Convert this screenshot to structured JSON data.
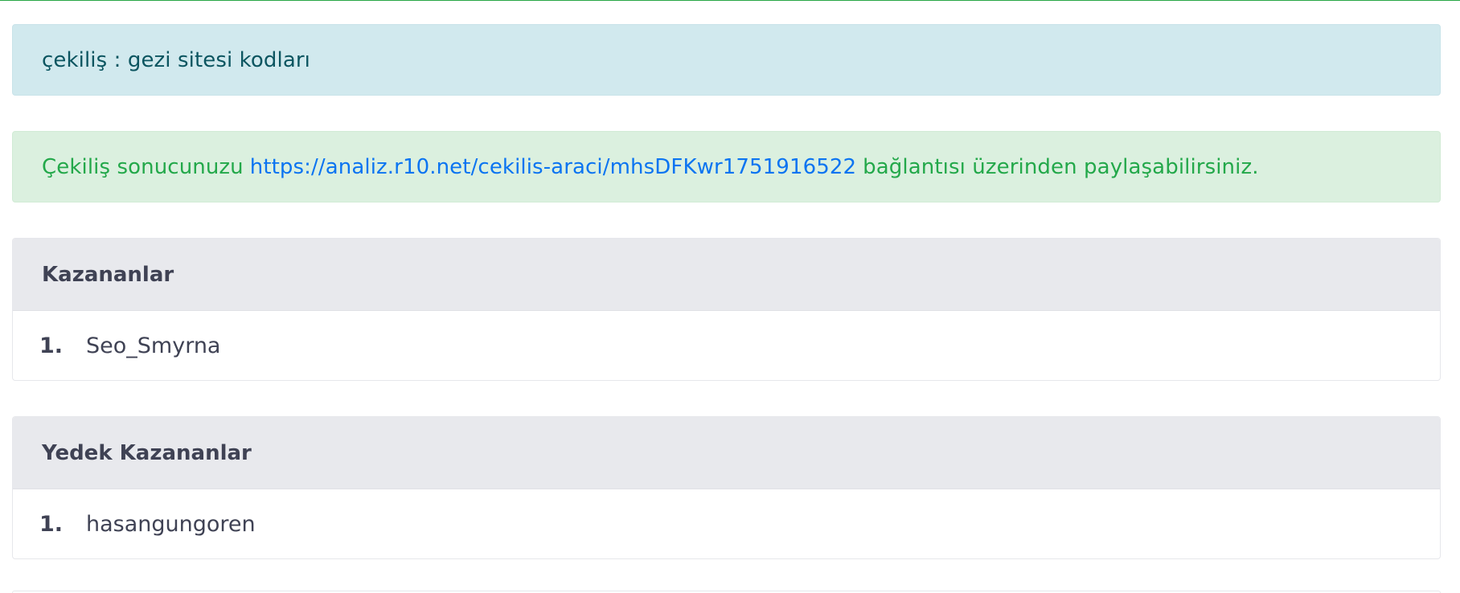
{
  "info_alert": {
    "text": "çekiliş : gezi sitesi kodları"
  },
  "success_alert": {
    "prefix": "Çekiliş sonucunuzu",
    "link": "https://analiz.r10.net/cekilis-araci/mhsDFKwr1751916522",
    "suffix": "bağlantısı üzerinden paylaşabilirsiniz."
  },
  "winners": {
    "title": "Kazananlar",
    "items": [
      {
        "rank": "1.",
        "name": "Seo_Smyrna"
      }
    ]
  },
  "backup_winners": {
    "title": "Yedek Kazananlar",
    "items": [
      {
        "rank": "1.",
        "name": "hasangungoren"
      }
    ]
  },
  "colors": {
    "info_bg": "#d1e9ee",
    "info_text": "#0b5560",
    "success_bg": "#dbf0df",
    "success_text": "#23a84a",
    "link": "#0b74f1",
    "card_header_bg": "#e8e9ed",
    "text": "#3f4254"
  }
}
